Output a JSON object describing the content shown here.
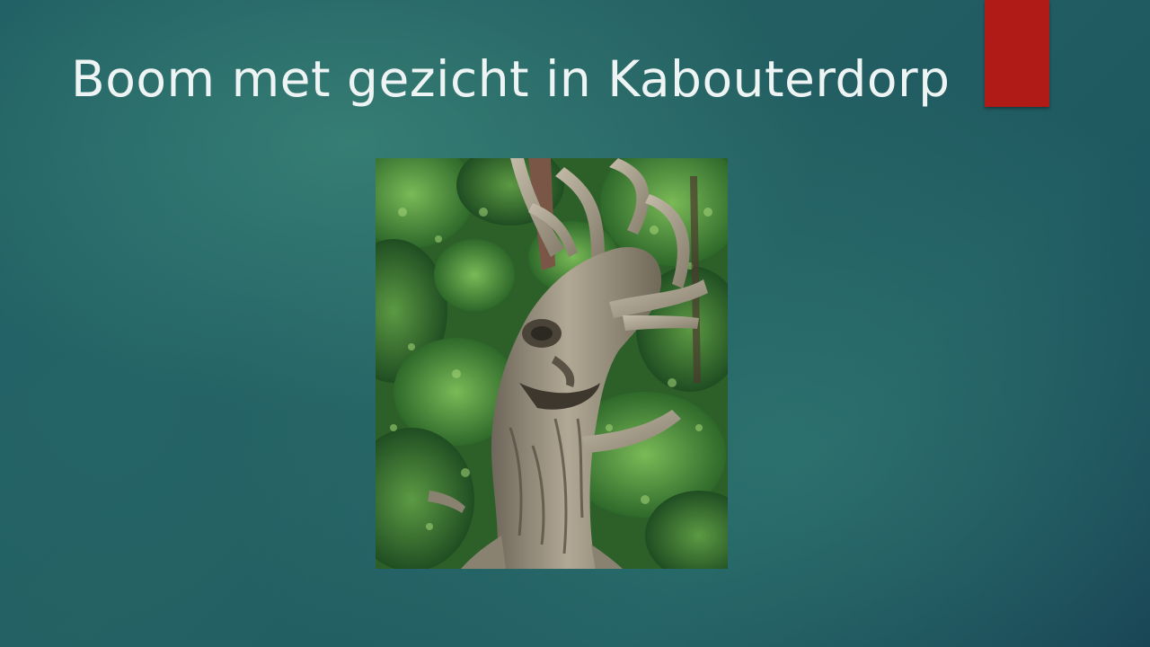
{
  "slide": {
    "title": "Boom met gezicht in Kabouterdorp",
    "image_icon": "tree-with-face-photo"
  },
  "colors": {
    "title_text": "#eef4f3",
    "accent": "#b01a17",
    "background": "#215c62",
    "foliage": "#3f7a35",
    "trunk": "#8e8676"
  }
}
